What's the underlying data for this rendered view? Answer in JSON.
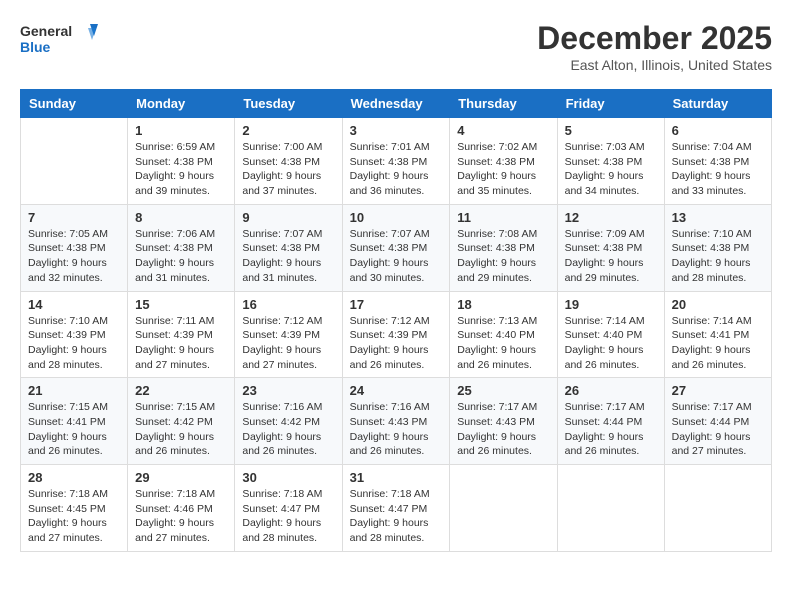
{
  "header": {
    "logo_line1": "General",
    "logo_line2": "Blue",
    "month": "December 2025",
    "location": "East Alton, Illinois, United States"
  },
  "days_of_week": [
    "Sunday",
    "Monday",
    "Tuesday",
    "Wednesday",
    "Thursday",
    "Friday",
    "Saturday"
  ],
  "weeks": [
    [
      {
        "day": "",
        "info": ""
      },
      {
        "day": "1",
        "info": "Sunrise: 6:59 AM\nSunset: 4:38 PM\nDaylight: 9 hours\nand 39 minutes."
      },
      {
        "day": "2",
        "info": "Sunrise: 7:00 AM\nSunset: 4:38 PM\nDaylight: 9 hours\nand 37 minutes."
      },
      {
        "day": "3",
        "info": "Sunrise: 7:01 AM\nSunset: 4:38 PM\nDaylight: 9 hours\nand 36 minutes."
      },
      {
        "day": "4",
        "info": "Sunrise: 7:02 AM\nSunset: 4:38 PM\nDaylight: 9 hours\nand 35 minutes."
      },
      {
        "day": "5",
        "info": "Sunrise: 7:03 AM\nSunset: 4:38 PM\nDaylight: 9 hours\nand 34 minutes."
      },
      {
        "day": "6",
        "info": "Sunrise: 7:04 AM\nSunset: 4:38 PM\nDaylight: 9 hours\nand 33 minutes."
      }
    ],
    [
      {
        "day": "7",
        "info": "Sunrise: 7:05 AM\nSunset: 4:38 PM\nDaylight: 9 hours\nand 32 minutes."
      },
      {
        "day": "8",
        "info": "Sunrise: 7:06 AM\nSunset: 4:38 PM\nDaylight: 9 hours\nand 31 minutes."
      },
      {
        "day": "9",
        "info": "Sunrise: 7:07 AM\nSunset: 4:38 PM\nDaylight: 9 hours\nand 31 minutes."
      },
      {
        "day": "10",
        "info": "Sunrise: 7:07 AM\nSunset: 4:38 PM\nDaylight: 9 hours\nand 30 minutes."
      },
      {
        "day": "11",
        "info": "Sunrise: 7:08 AM\nSunset: 4:38 PM\nDaylight: 9 hours\nand 29 minutes."
      },
      {
        "day": "12",
        "info": "Sunrise: 7:09 AM\nSunset: 4:38 PM\nDaylight: 9 hours\nand 29 minutes."
      },
      {
        "day": "13",
        "info": "Sunrise: 7:10 AM\nSunset: 4:38 PM\nDaylight: 9 hours\nand 28 minutes."
      }
    ],
    [
      {
        "day": "14",
        "info": "Sunrise: 7:10 AM\nSunset: 4:39 PM\nDaylight: 9 hours\nand 28 minutes."
      },
      {
        "day": "15",
        "info": "Sunrise: 7:11 AM\nSunset: 4:39 PM\nDaylight: 9 hours\nand 27 minutes."
      },
      {
        "day": "16",
        "info": "Sunrise: 7:12 AM\nSunset: 4:39 PM\nDaylight: 9 hours\nand 27 minutes."
      },
      {
        "day": "17",
        "info": "Sunrise: 7:12 AM\nSunset: 4:39 PM\nDaylight: 9 hours\nand 26 minutes."
      },
      {
        "day": "18",
        "info": "Sunrise: 7:13 AM\nSunset: 4:40 PM\nDaylight: 9 hours\nand 26 minutes."
      },
      {
        "day": "19",
        "info": "Sunrise: 7:14 AM\nSunset: 4:40 PM\nDaylight: 9 hours\nand 26 minutes."
      },
      {
        "day": "20",
        "info": "Sunrise: 7:14 AM\nSunset: 4:41 PM\nDaylight: 9 hours\nand 26 minutes."
      }
    ],
    [
      {
        "day": "21",
        "info": "Sunrise: 7:15 AM\nSunset: 4:41 PM\nDaylight: 9 hours\nand 26 minutes."
      },
      {
        "day": "22",
        "info": "Sunrise: 7:15 AM\nSunset: 4:42 PM\nDaylight: 9 hours\nand 26 minutes."
      },
      {
        "day": "23",
        "info": "Sunrise: 7:16 AM\nSunset: 4:42 PM\nDaylight: 9 hours\nand 26 minutes."
      },
      {
        "day": "24",
        "info": "Sunrise: 7:16 AM\nSunset: 4:43 PM\nDaylight: 9 hours\nand 26 minutes."
      },
      {
        "day": "25",
        "info": "Sunrise: 7:17 AM\nSunset: 4:43 PM\nDaylight: 9 hours\nand 26 minutes."
      },
      {
        "day": "26",
        "info": "Sunrise: 7:17 AM\nSunset: 4:44 PM\nDaylight: 9 hours\nand 26 minutes."
      },
      {
        "day": "27",
        "info": "Sunrise: 7:17 AM\nSunset: 4:44 PM\nDaylight: 9 hours\nand 27 minutes."
      }
    ],
    [
      {
        "day": "28",
        "info": "Sunrise: 7:18 AM\nSunset: 4:45 PM\nDaylight: 9 hours\nand 27 minutes."
      },
      {
        "day": "29",
        "info": "Sunrise: 7:18 AM\nSunset: 4:46 PM\nDaylight: 9 hours\nand 27 minutes."
      },
      {
        "day": "30",
        "info": "Sunrise: 7:18 AM\nSunset: 4:47 PM\nDaylight: 9 hours\nand 28 minutes."
      },
      {
        "day": "31",
        "info": "Sunrise: 7:18 AM\nSunset: 4:47 PM\nDaylight: 9 hours\nand 28 minutes."
      },
      {
        "day": "",
        "info": ""
      },
      {
        "day": "",
        "info": ""
      },
      {
        "day": "",
        "info": ""
      }
    ]
  ]
}
